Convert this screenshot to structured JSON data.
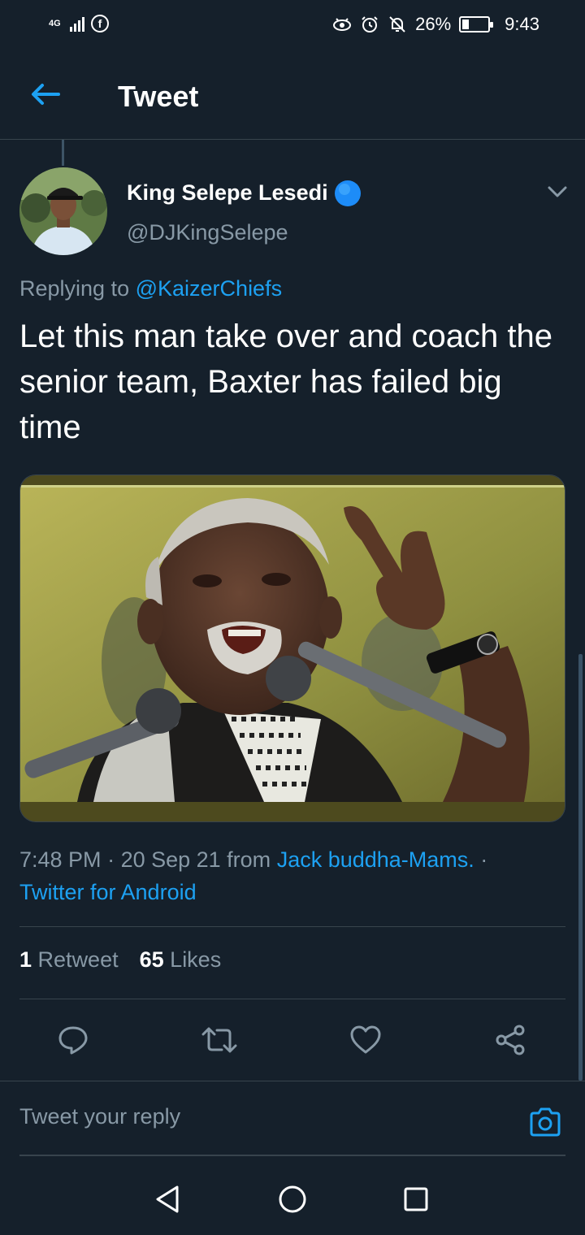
{
  "status_bar": {
    "network": "4G",
    "battery": "26%",
    "battery_level": 0.26,
    "time": "9:43",
    "icons": [
      "signal-icon",
      "facebook-icon",
      "eye-icon",
      "alarm-icon",
      "mute-icon",
      "battery-icon"
    ]
  },
  "header": {
    "title": "Tweet",
    "back_icon": "arrow-left-icon"
  },
  "tweet": {
    "author_name": "King Selepe Lesedi",
    "author_handle": "@DJKingSelepe",
    "verified": true,
    "replying_prefix": "Replying to",
    "replying_to": "@KaizerChiefs",
    "text": "Let this man take over and coach the senior team, Baxter has failed big time",
    "time": "7:48 PM",
    "sep1": " · ",
    "date": "20 Sep 21",
    "from_label": " from ",
    "location": "Jack buddha-Mams.",
    "sep2": " · ",
    "source": "Twitter for Android"
  },
  "stats": {
    "retweets_count": "1",
    "retweets_label": "Retweet",
    "likes_count": "65",
    "likes_label": "Likes"
  },
  "actions": [
    "reply-icon",
    "retweet-icon",
    "like-icon",
    "share-icon"
  ],
  "reply_bar": {
    "placeholder": "Tweet your reply",
    "camera_icon": "camera-icon"
  },
  "nav": [
    "back-triangle-icon",
    "home-circle-icon",
    "recents-square-icon"
  ],
  "colors": {
    "background": "#15202b",
    "accent": "#1da1f2",
    "secondary_text": "#8899a6",
    "divider": "#38444d"
  }
}
